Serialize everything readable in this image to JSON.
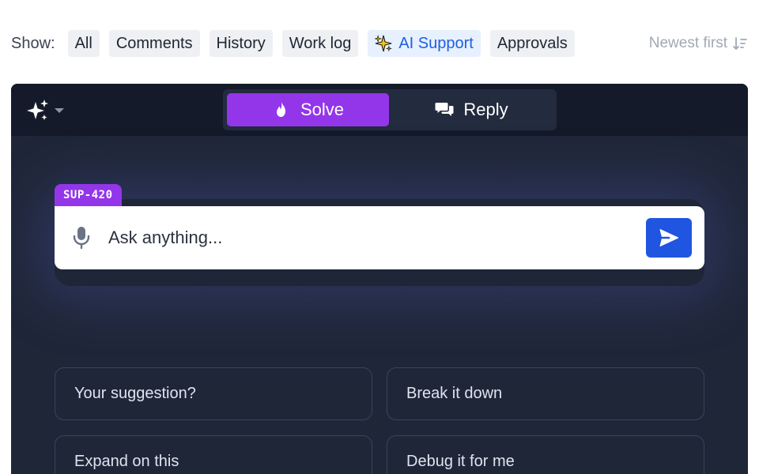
{
  "filters": {
    "show_label": "Show:",
    "chips": [
      {
        "label": "All",
        "active": false
      },
      {
        "label": "Comments",
        "active": false
      },
      {
        "label": "History",
        "active": false
      },
      {
        "label": "Work log",
        "active": false
      },
      {
        "label": "AI Support",
        "active": true,
        "icon": "sparkles-icon"
      },
      {
        "label": "Approvals",
        "active": false
      }
    ],
    "sort_label": "Newest first",
    "sort_icon": "sort-descending-icon"
  },
  "panel": {
    "ai_menu_icon": "sparkles-icon",
    "modes": [
      {
        "label": "Solve",
        "icon": "flame-icon",
        "active": true
      },
      {
        "label": "Reply",
        "icon": "chat-bubbles-icon",
        "active": false
      }
    ],
    "ticket_key": "SUP-420",
    "ask": {
      "placeholder": "Ask anything...",
      "value": ""
    },
    "suggestions": [
      "Your suggestion?",
      "Break it down",
      "Expand on this",
      "Debug it for me"
    ]
  },
  "colors": {
    "accent_purple": "#9336ea",
    "send_blue": "#1f55e0",
    "panel_bg": "#1f2638",
    "panel_header_bg": "#141a29",
    "active_chip_text": "#1f5fe0"
  }
}
